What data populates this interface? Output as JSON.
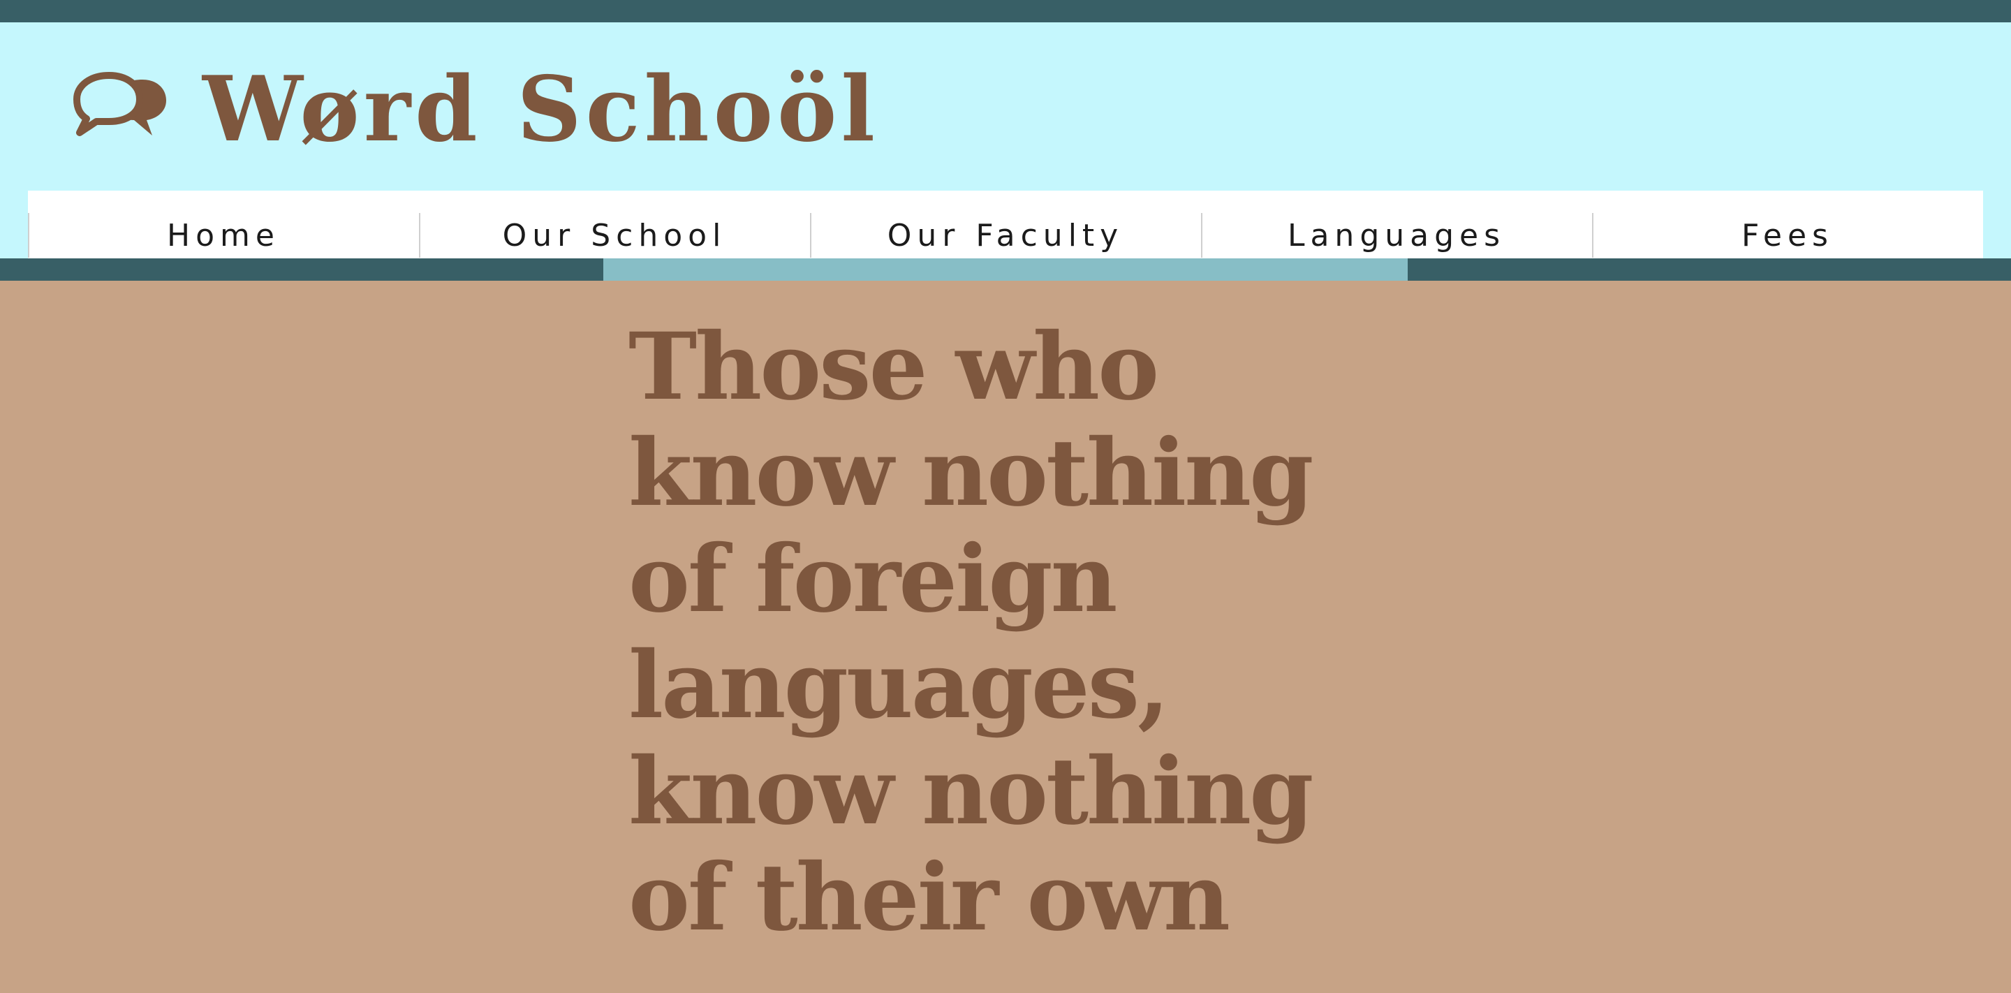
{
  "brand": {
    "name": "Wørd Schoöl",
    "icon": "speech-bubbles-icon",
    "color": "#7e573e"
  },
  "nav": {
    "items": [
      {
        "label": "Home"
      },
      {
        "label": "Our School"
      },
      {
        "label": "Our Faculty"
      },
      {
        "label": "Languages"
      },
      {
        "label": "Fees"
      }
    ]
  },
  "hero": {
    "quote": "Those who know nothing of foreign languages, know nothing of their own"
  },
  "colors": {
    "header_bg": "#c5f7fd",
    "bar": "#385f66",
    "bar_active": "#87bec6",
    "hero_bg": "#c7a386",
    "text_brown": "#7e573e"
  }
}
